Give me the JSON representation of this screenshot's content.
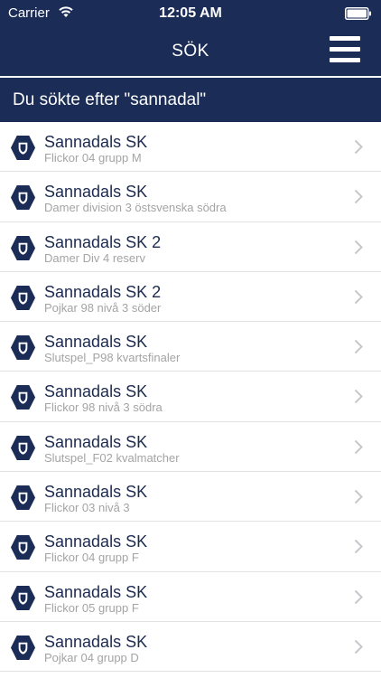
{
  "status_bar": {
    "carrier": "Carrier",
    "time": "12:05 AM"
  },
  "nav": {
    "title": "SÖK"
  },
  "search": {
    "query_text": "Du sökte efter \"sannadal\""
  },
  "colors": {
    "nav_background": "#1b2c56",
    "team_text": "#1c2a4f",
    "subtitle_text": "#a4a4a4",
    "divider": "#e2e2e2"
  },
  "results": [
    {
      "team": "Sannadals SK",
      "league": "Flickor 04 grupp M"
    },
    {
      "team": "Sannadals SK",
      "league": "Damer division 3 östsvenska södra"
    },
    {
      "team": "Sannadals SK 2",
      "league": "Damer Div 4 reserv"
    },
    {
      "team": "Sannadals SK 2",
      "league": "Pojkar 98 nivå 3 söder"
    },
    {
      "team": "Sannadals SK",
      "league": "Slutspel_P98 kvartsfinaler"
    },
    {
      "team": "Sannadals SK",
      "league": "Flickor 98 nivå 3 södra"
    },
    {
      "team": "Sannadals SK",
      "league": "Slutspel_F02 kvalmatcher"
    },
    {
      "team": "Sannadals SK",
      "league": "Flickor 03 nivå 3"
    },
    {
      "team": "Sannadals SK",
      "league": "Flickor 04 grupp F"
    },
    {
      "team": "Sannadals SK",
      "league": "Flickor 05 grupp F"
    },
    {
      "team": "Sannadals SK",
      "league": "Pojkar 04 grupp D"
    }
  ]
}
